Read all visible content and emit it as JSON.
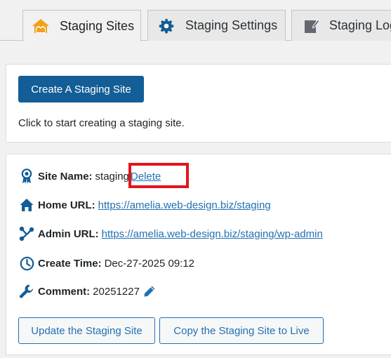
{
  "tabs": [
    {
      "label": "Staging Sites",
      "icon": "staging-home-icon",
      "active": true
    },
    {
      "label": "Staging Settings",
      "icon": "gear-icon",
      "active": false
    },
    {
      "label": "Staging Logs",
      "icon": "edit-log-icon",
      "active": false
    }
  ],
  "create": {
    "button_label": "Create A Staging Site",
    "hint": "Click to start creating a staging site."
  },
  "site": {
    "name_label": "Site Name:",
    "name_value": "staging",
    "delete_label": "Delete",
    "home_label": "Home URL:",
    "home_url": "https://amelia.web-design.biz/staging",
    "admin_label": "Admin URL:",
    "admin_url": "https://amelia.web-design.biz/staging/wp-admin",
    "time_label": "Create Time:",
    "time_value": "Dec-27-2025 09:12",
    "comment_label": "Comment:",
    "comment_value": "20251227",
    "update_button": "Update the Staging Site",
    "copy_button": "Copy the Staging Site to Live"
  },
  "colors": {
    "accent": "#2271b1",
    "primary_button": "#135e96",
    "highlight": "#e3141b",
    "staging_icon": "#f0a21b"
  }
}
